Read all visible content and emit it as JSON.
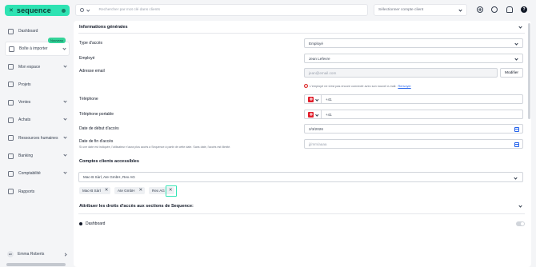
{
  "app": {
    "brand": "sequence",
    "logo_mark": "✕"
  },
  "sidebar": {
    "items": [
      {
        "label": "Dashboard",
        "icon": "home-icon",
        "has_chevron": false
      },
      {
        "label": "Boîte à importer",
        "icon": "inbox-icon",
        "has_chevron": true,
        "badge": "Nouveau"
      },
      {
        "label": "Mon espace",
        "icon": "user-icon",
        "has_chevron": true
      },
      {
        "label": "Projets",
        "icon": "check-square-icon",
        "has_chevron": false
      },
      {
        "label": "Ventes",
        "icon": "bag-icon",
        "has_chevron": true
      },
      {
        "label": "Achats",
        "icon": "cart-icon",
        "has_chevron": true
      },
      {
        "label": "Ressources humaines",
        "icon": "people-icon",
        "has_chevron": true
      },
      {
        "label": "Banking",
        "icon": "bank-icon",
        "has_chevron": true
      },
      {
        "label": "Comptabilité",
        "icon": "ledger-icon",
        "has_chevron": true
      },
      {
        "label": "Rapports",
        "icon": "chart-icon",
        "has_chevron": false
      }
    ],
    "user": {
      "initials": "ER",
      "name": "Emma Roberts"
    }
  },
  "topbar": {
    "search_placeholder": "Rechercher par mot clé dans clients",
    "client_select_placeholder": "Sélectionner compte client",
    "help_glyph": "?"
  },
  "general": {
    "title": "Informations générales",
    "access_type": {
      "label": "Type d'accès",
      "value": "Employé"
    },
    "employee": {
      "label": "Employé",
      "value": "Jean Lefevre"
    },
    "email": {
      "label": "Adresse email",
      "value": "jean@email.com",
      "button": "Modifier",
      "warning": "L'employé ne s'est pas encore connecté avec son nouvel e-mail.",
      "warning_link": "Renvoyer"
    },
    "phone": {
      "label": "Téléphone",
      "value": "+41"
    },
    "mobile": {
      "label": "Téléphone portable",
      "value": "+41"
    },
    "start_date": {
      "label": "Date de début d'accès",
      "value": "2/3/2026"
    },
    "end_date": {
      "label": "Date de fin d'accès",
      "help": "Si une date est indiquée, l'utilisateur n'aura plus accès à Sequence à partir de cette date. Sans date, l'accès est illimité.",
      "placeholder": "jj/mm/aaaa"
    }
  },
  "accounts": {
    "title": "Comptes clients accessibles",
    "selected_text": "Mac-B Sàrl, Ate GmbH, Rex AG",
    "chips": [
      "Mac-B Sàrl",
      "Ate GmbH",
      "Rex AG"
    ],
    "chip_remove_glyph": "✕"
  },
  "rights": {
    "title": "Attribuer les droits d'accès aux sections de Sequence:",
    "items": [
      {
        "label": "Dashboard",
        "enabled": false
      }
    ]
  }
}
